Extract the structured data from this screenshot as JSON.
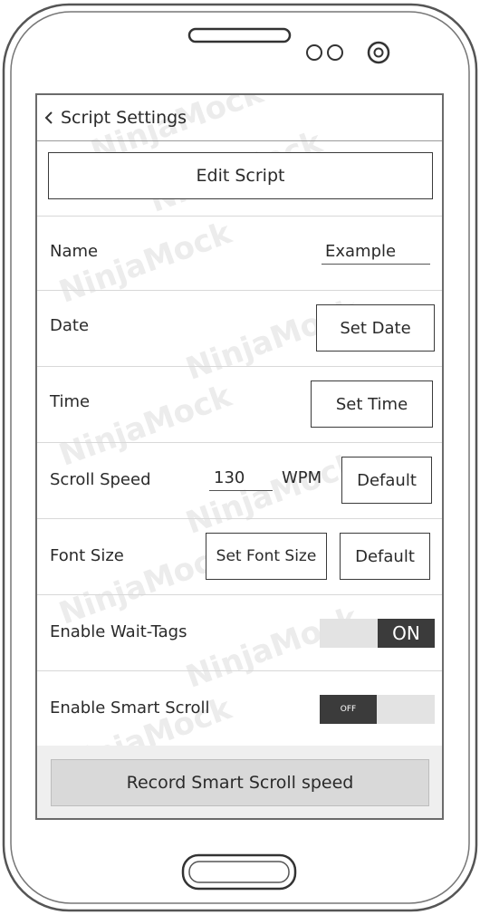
{
  "header": {
    "title": "Script Settings"
  },
  "edit_script": {
    "label": "Edit Script"
  },
  "name_row": {
    "label": "Name",
    "value": "Example"
  },
  "date_row": {
    "label": "Date",
    "button": "Set Date"
  },
  "time_row": {
    "label": "Time",
    "button": "Set Time"
  },
  "scroll_speed_row": {
    "label": "Scroll Speed",
    "value": "130",
    "unit": "WPM",
    "default_button": "Default"
  },
  "font_size_row": {
    "label": "Font Size",
    "button": "Set Font Size",
    "default_button": "Default"
  },
  "wait_tags_row": {
    "label": "Enable Wait-Tags",
    "state": "ON"
  },
  "smart_scroll_row": {
    "label": "Enable Smart Scroll",
    "state": "OFF"
  },
  "record_button": {
    "label": "Record Smart Scroll speed"
  },
  "watermark": "NinjaMock"
}
